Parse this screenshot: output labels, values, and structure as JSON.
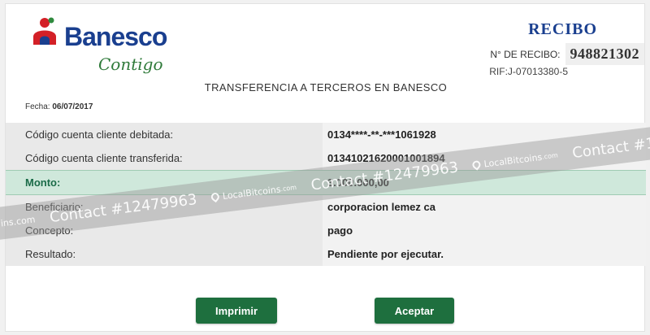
{
  "brand": {
    "name": "Banesco",
    "tagline": "Contigo"
  },
  "header": {
    "receipt_title": "RECIBO",
    "receipt_number_label": "N° DE RECIBO:",
    "receipt_number": "948821302",
    "rif": "RIF:J-07013380-5"
  },
  "document": {
    "title": "TRANSFERENCIA A TERCEROS EN BANESCO",
    "date_label": "Fecha:",
    "date": "06/07/2017"
  },
  "details": [
    {
      "label": "Código cuenta cliente debitada:",
      "value": "0134****-**-***1061928"
    },
    {
      "label": "Código cuenta cliente transferida:",
      "value": "01341021620001001894"
    },
    {
      "label": "Monto:",
      "value": "3.000.000,00"
    },
    {
      "label": "Beneficiario:",
      "value": "corporacion lemez ca"
    },
    {
      "label": "Concepto:",
      "value": "pago"
    },
    {
      "label": "Resultado:",
      "value": "Pendiente por ejecutar."
    }
  ],
  "buttons": {
    "print": "Imprimir",
    "accept": "Aceptar"
  },
  "watermark": {
    "prefix": "ins.com",
    "contact": "Contact #12479963",
    "site": "LocalBitcoins",
    "site_suffix": ".com",
    "contact_cut": "Contact #1"
  },
  "colors": {
    "brand_blue": "#1a3f8f",
    "brand_green": "#1e6f3e",
    "highlight": "#cfe8db",
    "logo_red": "#d32027"
  }
}
